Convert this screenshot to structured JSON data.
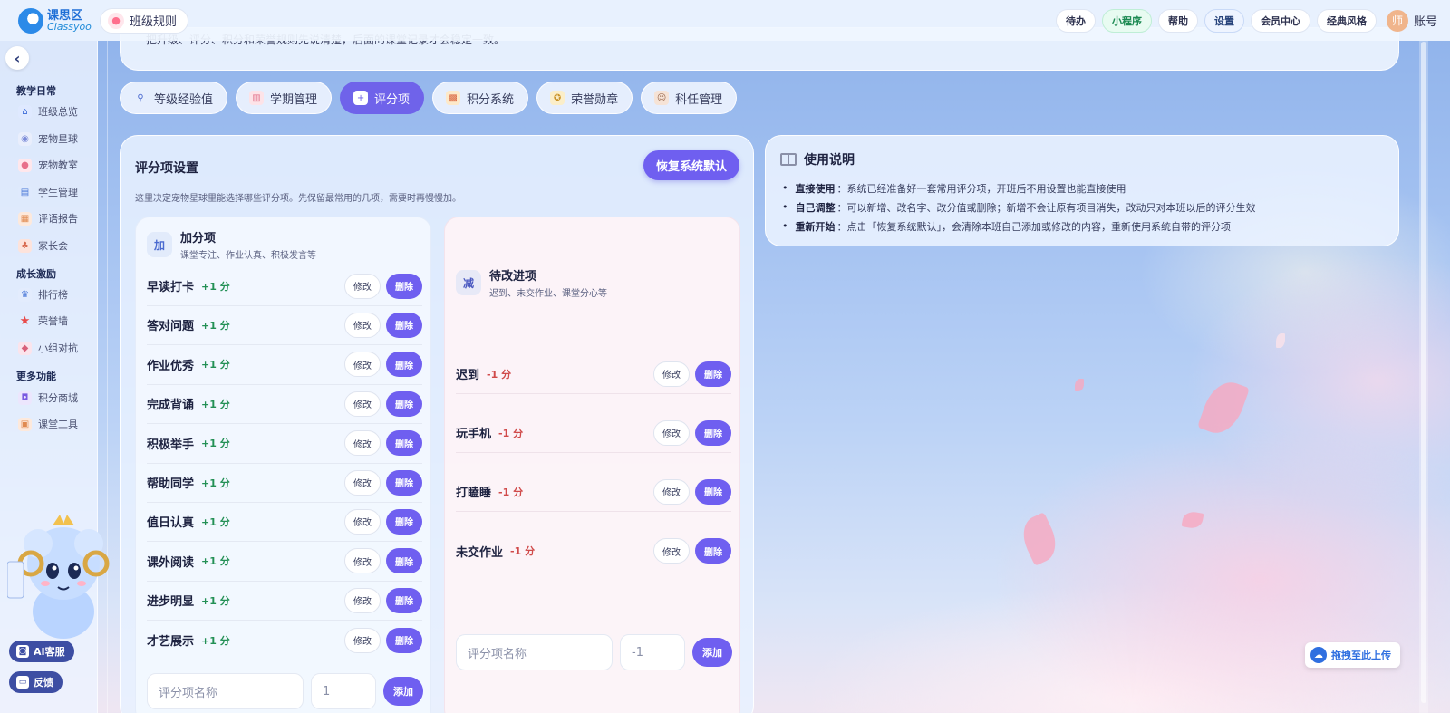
{
  "header": {
    "logo_cn": "课思区",
    "logo_en": "Classyoo",
    "class_chip": "班级规则",
    "buttons": [
      "待办",
      "小程序",
      "帮助",
      "设置",
      "会员中心",
      "经典风格"
    ],
    "avatar_text": "师",
    "account_label": "账号"
  },
  "sidebar": {
    "back_glyph": "‹",
    "groups": [
      {
        "title": "教学日常",
        "items": [
          "班级总览",
          "宠物星球",
          "宠物教室",
          "学生管理",
          "评语报告",
          "家长会"
        ]
      },
      {
        "title": "成长激励",
        "items": [
          "排行榜",
          "荣誉墙",
          "小组对抗"
        ]
      },
      {
        "title": "更多功能",
        "items": [
          "积分商城",
          "课堂工具"
        ]
      }
    ],
    "ai_service": "AI客服",
    "feedback": "反馈"
  },
  "banner": {
    "text": "把升级、评分、积分和荣誉规则先说清楚，后面的课堂记录才会稳定一致。"
  },
  "tabs": [
    {
      "label": "等级经验值",
      "icon": "magnifier-icon",
      "active": false
    },
    {
      "label": "学期管理",
      "icon": "chart-icon",
      "active": false
    },
    {
      "label": "评分项",
      "icon": "plus-square-icon",
      "active": true
    },
    {
      "label": "积分系统",
      "icon": "gift-icon",
      "active": false
    },
    {
      "label": "荣誉勋章",
      "icon": "medal-icon",
      "active": false
    },
    {
      "label": "科任管理",
      "icon": "teacher-icon",
      "active": false
    }
  ],
  "scoring": {
    "title": "评分项设置",
    "restore_label": "恢复系统默认",
    "desc": "这里决定宠物星球里能选择哪些评分项。先保留最常用的几项，需要时再慢慢加。",
    "edit_label": "修改",
    "delete_label": "删除",
    "add_label": "添加",
    "name_placeholder": "评分项名称",
    "plus": {
      "badge": "加",
      "title": "加分项",
      "subtitle": "课堂专注、作业认真、积极发言等",
      "default_value": "1",
      "items": [
        {
          "name": "早读打卡",
          "value": "+1 分"
        },
        {
          "name": "答对问题",
          "value": "+1 分"
        },
        {
          "name": "作业优秀",
          "value": "+1 分"
        },
        {
          "name": "完成背诵",
          "value": "+1 分"
        },
        {
          "name": "积极举手",
          "value": "+1 分"
        },
        {
          "name": "帮助同学",
          "value": "+1 分"
        },
        {
          "name": "值日认真",
          "value": "+1 分"
        },
        {
          "name": "课外阅读",
          "value": "+1 分"
        },
        {
          "name": "进步明显",
          "value": "+1 分"
        },
        {
          "name": "才艺展示",
          "value": "+1 分"
        }
      ]
    },
    "minus": {
      "badge": "减",
      "title": "待改进项",
      "subtitle": "迟到、未交作业、课堂分心等",
      "default_value": "-1",
      "items": [
        {
          "name": "迟到",
          "value": "-1 分"
        },
        {
          "name": "玩手机",
          "value": "-1 分"
        },
        {
          "name": "打瞌睡",
          "value": "-1 分"
        },
        {
          "name": "未交作业",
          "value": "-1 分"
        }
      ]
    }
  },
  "help": {
    "title": "使用说明",
    "items": [
      {
        "label": "直接使用",
        "text": "：系统已经准备好一套常用评分项，开班后不用设置也能直接使用"
      },
      {
        "label": "自己调整",
        "text": "：可以新增、改名字、改分值或删除；新增不会让原有项目消失，改动只对本班以后的评分生效"
      },
      {
        "label": "重新开始",
        "text": "：点击「恢复系统默认」，会清除本班自己添加或修改的内容，重新使用系统自带的评分项"
      }
    ]
  },
  "upload_label": "拖拽至此上传",
  "colors": {
    "accent": "#6f5ff0",
    "positive": "#239055",
    "negative": "#d04a4a"
  }
}
